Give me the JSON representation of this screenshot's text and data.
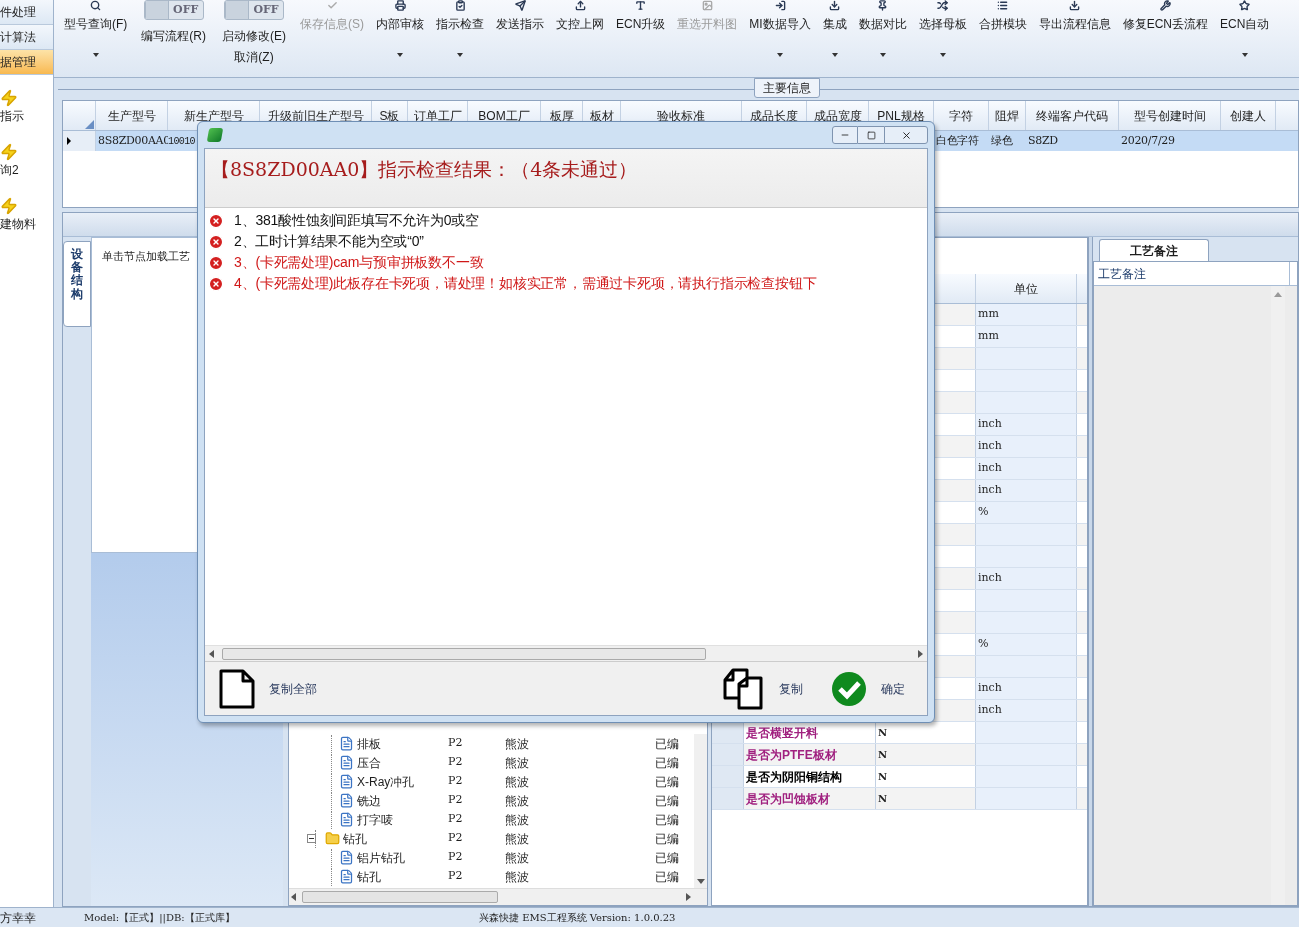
{
  "sidebar": {
    "items": [
      {
        "label": "件处理",
        "kind": "text",
        "selected": false
      },
      {
        "label": "计算法",
        "kind": "text",
        "selected": false
      },
      {
        "label": "据管理",
        "kind": "text",
        "selected": true
      },
      {
        "label": "指示",
        "kind": "icon",
        "selected": false
      },
      {
        "label": "询2",
        "kind": "icon",
        "selected": false
      },
      {
        "label": "建物料",
        "kind": "icon",
        "selected": false
      }
    ]
  },
  "ribbon": {
    "items": [
      {
        "kind": "button",
        "label": "型号查询(F)",
        "dropdown": true,
        "disabled": false
      },
      {
        "kind": "toggle",
        "toggle": "OFF",
        "on": false,
        "label": "编写流程(R)"
      },
      {
        "kind": "toggle",
        "toggle": "OFF",
        "on": false,
        "label": "启动修改(E)",
        "label2": "取消(Z)"
      },
      {
        "kind": "button",
        "label": "保存信息(S)",
        "dropdown": false,
        "disabled": true
      },
      {
        "kind": "button",
        "label": "内部审核",
        "dropdown": true,
        "disabled": false
      },
      {
        "kind": "button",
        "label": "指示检查",
        "dropdown": true,
        "disabled": false
      },
      {
        "kind": "button",
        "label": "发送指示",
        "dropdown": false,
        "disabled": false
      },
      {
        "kind": "button",
        "label": "文控上网",
        "dropdown": false,
        "disabled": false
      },
      {
        "kind": "button",
        "label": "ECN升级",
        "dropdown": false,
        "disabled": false
      },
      {
        "kind": "button",
        "label": "重选开料图",
        "dropdown": false,
        "disabled": true
      },
      {
        "kind": "button",
        "label": "MI数据导入",
        "dropdown": true,
        "disabled": false
      },
      {
        "kind": "button",
        "label": "集成",
        "dropdown": true,
        "disabled": false
      },
      {
        "kind": "button",
        "label": "数据对比",
        "dropdown": true,
        "disabled": false
      },
      {
        "kind": "button",
        "label": "选择母板",
        "dropdown": true,
        "disabled": false
      },
      {
        "kind": "button",
        "label": "合拼模块",
        "dropdown": false,
        "disabled": false
      },
      {
        "kind": "button",
        "label": "导出流程信息",
        "dropdown": false,
        "disabled": false
      },
      {
        "kind": "button",
        "label": "修复ECN丢流程",
        "dropdown": false,
        "disabled": false
      },
      {
        "kind": "button",
        "label": "ECN自动",
        "dropdown": true,
        "disabled": false
      }
    ]
  },
  "main_info": {
    "title": "主要信息",
    "columns": [
      {
        "label": "生产型号",
        "cell": "8S8ZD00AA0"
      },
      {
        "label": "新生产型号",
        "cell": "10010"
      },
      {
        "label": "升级前旧生产型号"
      },
      {
        "label": "S板"
      },
      {
        "label": "订单工厂"
      },
      {
        "label": "BOM工厂"
      },
      {
        "label": "板厚"
      },
      {
        "label": "板材"
      },
      {
        "label": "验收标准"
      },
      {
        "label": "成品长度"
      },
      {
        "label": "成品宽度"
      },
      {
        "label": "PNL规格"
      },
      {
        "label": "字符",
        "cell": "白色字符"
      },
      {
        "label": "阻焊",
        "cell": "绿色"
      },
      {
        "label": "终端客户代码",
        "cell": "S8ZD"
      },
      {
        "label": "型号创建时间",
        "cell": "2020/7/29"
      },
      {
        "label": "创建人"
      }
    ],
    "row_selected": true
  },
  "equipment_tab": {
    "label": "设备结构",
    "selected": true
  },
  "tree_hint": "单击节点加载工艺",
  "tree": [
    {
      "kind": "continued",
      "children": [
        {
          "label": "排板",
          "kind": "file",
          "column_2": "P2",
          "column_3": "熊波",
          "column_5": "已编"
        },
        {
          "label": "压合",
          "kind": "file",
          "column_2": "P2",
          "column_3": "熊波",
          "column_5": "已编"
        },
        {
          "label": "X-Ray冲孔",
          "kind": "file",
          "column_2": "P2",
          "column_3": "熊波",
          "column_5": "已编"
        },
        {
          "label": "铣边",
          "kind": "file",
          "column_2": "P2",
          "column_3": "熊波",
          "column_5": "已编"
        },
        {
          "label": "打字唛",
          "kind": "file",
          "column_2": "P2",
          "column_3": "熊波",
          "column_5": "已编"
        }
      ]
    },
    {
      "label": "钻孔",
      "kind": "folder",
      "expanded": true,
      "column_2": "P2",
      "column_3": "熊波",
      "column_5": "已编",
      "children": [
        {
          "label": "铝片钻孔",
          "kind": "file",
          "column_2": "P2",
          "column_3": "熊波",
          "column_5": "已编"
        },
        {
          "label": "钻孔",
          "kind": "file",
          "column_2": "P2",
          "column_3": "熊波",
          "column_5": "已编"
        }
      ]
    }
  ],
  "property_grid": {
    "unit_header": "单位",
    "rows": [
      {
        "unit": "mm"
      },
      {
        "unit": "mm"
      },
      {},
      {},
      {},
      {
        "unit": "inch"
      },
      {
        "unit": "inch"
      },
      {
        "unit": "inch"
      },
      {
        "unit": "inch"
      },
      {
        "unit": "%"
      },
      {},
      {},
      {
        "unit": "inch"
      },
      {},
      {},
      {
        "unit": "%"
      },
      {},
      {
        "unit": "inch"
      },
      {
        "unit": "inch"
      },
      {
        "name": "是否横竖开料",
        "value": "N",
        "color": "#a0207f"
      },
      {
        "name": "是否为PTFE板材",
        "value": "N",
        "color": "#a0207f"
      },
      {
        "name": "是否为阴阳铜结构",
        "value": "N",
        "color": "#000000"
      },
      {
        "name": "是否为凹蚀板材",
        "value": "N",
        "color": "#a0207f"
      }
    ]
  },
  "notes_panel": {
    "tab": {
      "label": "工艺备注",
      "selected": true
    },
    "columns": [
      "工艺备注"
    ]
  },
  "dialog": {
    "heading": "【8S8ZD00AA0】指示检查结果：（4条未通过）",
    "messages": [
      {
        "text": "1、381酸性蚀刻间距填写不允许为0或空",
        "kind": "normal"
      },
      {
        "text": "2、工时计算结果不能为空或“0”",
        "kind": "normal"
      },
      {
        "text": "3、(卡死需处理)cam与预审拼板数不一致",
        "kind": "blocking"
      },
      {
        "text": "4、(卡死需处理)此板存在卡死项，请处理！如核实正常，需通过卡死项，请执行指示检查按钮下",
        "kind": "blocking"
      }
    ],
    "buttons": [
      {
        "label": "复制全部",
        "kind": "copy_all"
      },
      {
        "label": "复制",
        "kind": "copy"
      },
      {
        "label": "确定",
        "kind": "ok"
      }
    ]
  },
  "status_bar": [
    "方幸幸",
    "Model:【正式】||DB:【正式库】",
    "兴森快捷 EMS工程系统 Version: 1.0.0.23"
  ]
}
